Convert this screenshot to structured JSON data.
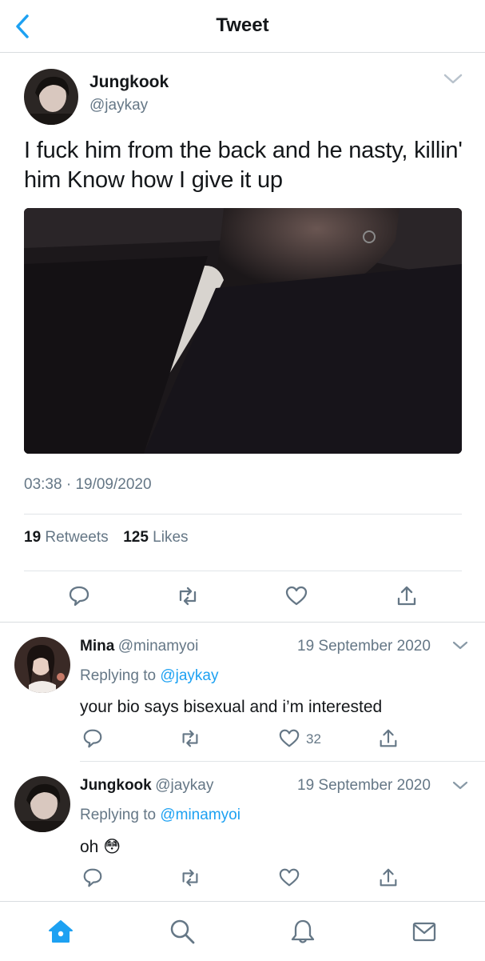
{
  "header": {
    "title": "Tweet"
  },
  "tweet": {
    "author_name": "Jungkook",
    "author_handle": "@jaykay",
    "text": "I fuck him from the back and he nasty, killin' him Know how I give it up",
    "time": "03:38",
    "date_separator": "·",
    "date": "19/09/2020",
    "retweets_count": "19",
    "retweets_label": "Retweets",
    "likes_count": "125",
    "likes_label": "Likes"
  },
  "replies": [
    {
      "name": "Mina",
      "handle": "@minamyoi",
      "date": "19 September 2020",
      "replying_prefix": "Replying to",
      "replying_to": "@jaykay",
      "text": "your bio says bisexual and i’m interested",
      "like_count": "32"
    },
    {
      "name": "Jungkook",
      "handle": "@jaykay",
      "date": "19 September 2020",
      "replying_prefix": "Replying to",
      "replying_to": "@minamyoi",
      "text": "oh",
      "emoji": "😳",
      "like_count": ""
    }
  ],
  "icons": {
    "back": "chevron-left-icon",
    "more": "chevron-down-icon",
    "reply": "speech-bubble-icon",
    "retweet": "retweet-icon",
    "like": "heart-icon",
    "share": "share-icon",
    "home": "home-icon",
    "search": "search-icon",
    "notifications": "bell-icon",
    "messages": "envelope-icon"
  },
  "colors": {
    "accent": "#1da1f2",
    "secondary_text": "#657786",
    "divider": "#e1e5e8"
  }
}
